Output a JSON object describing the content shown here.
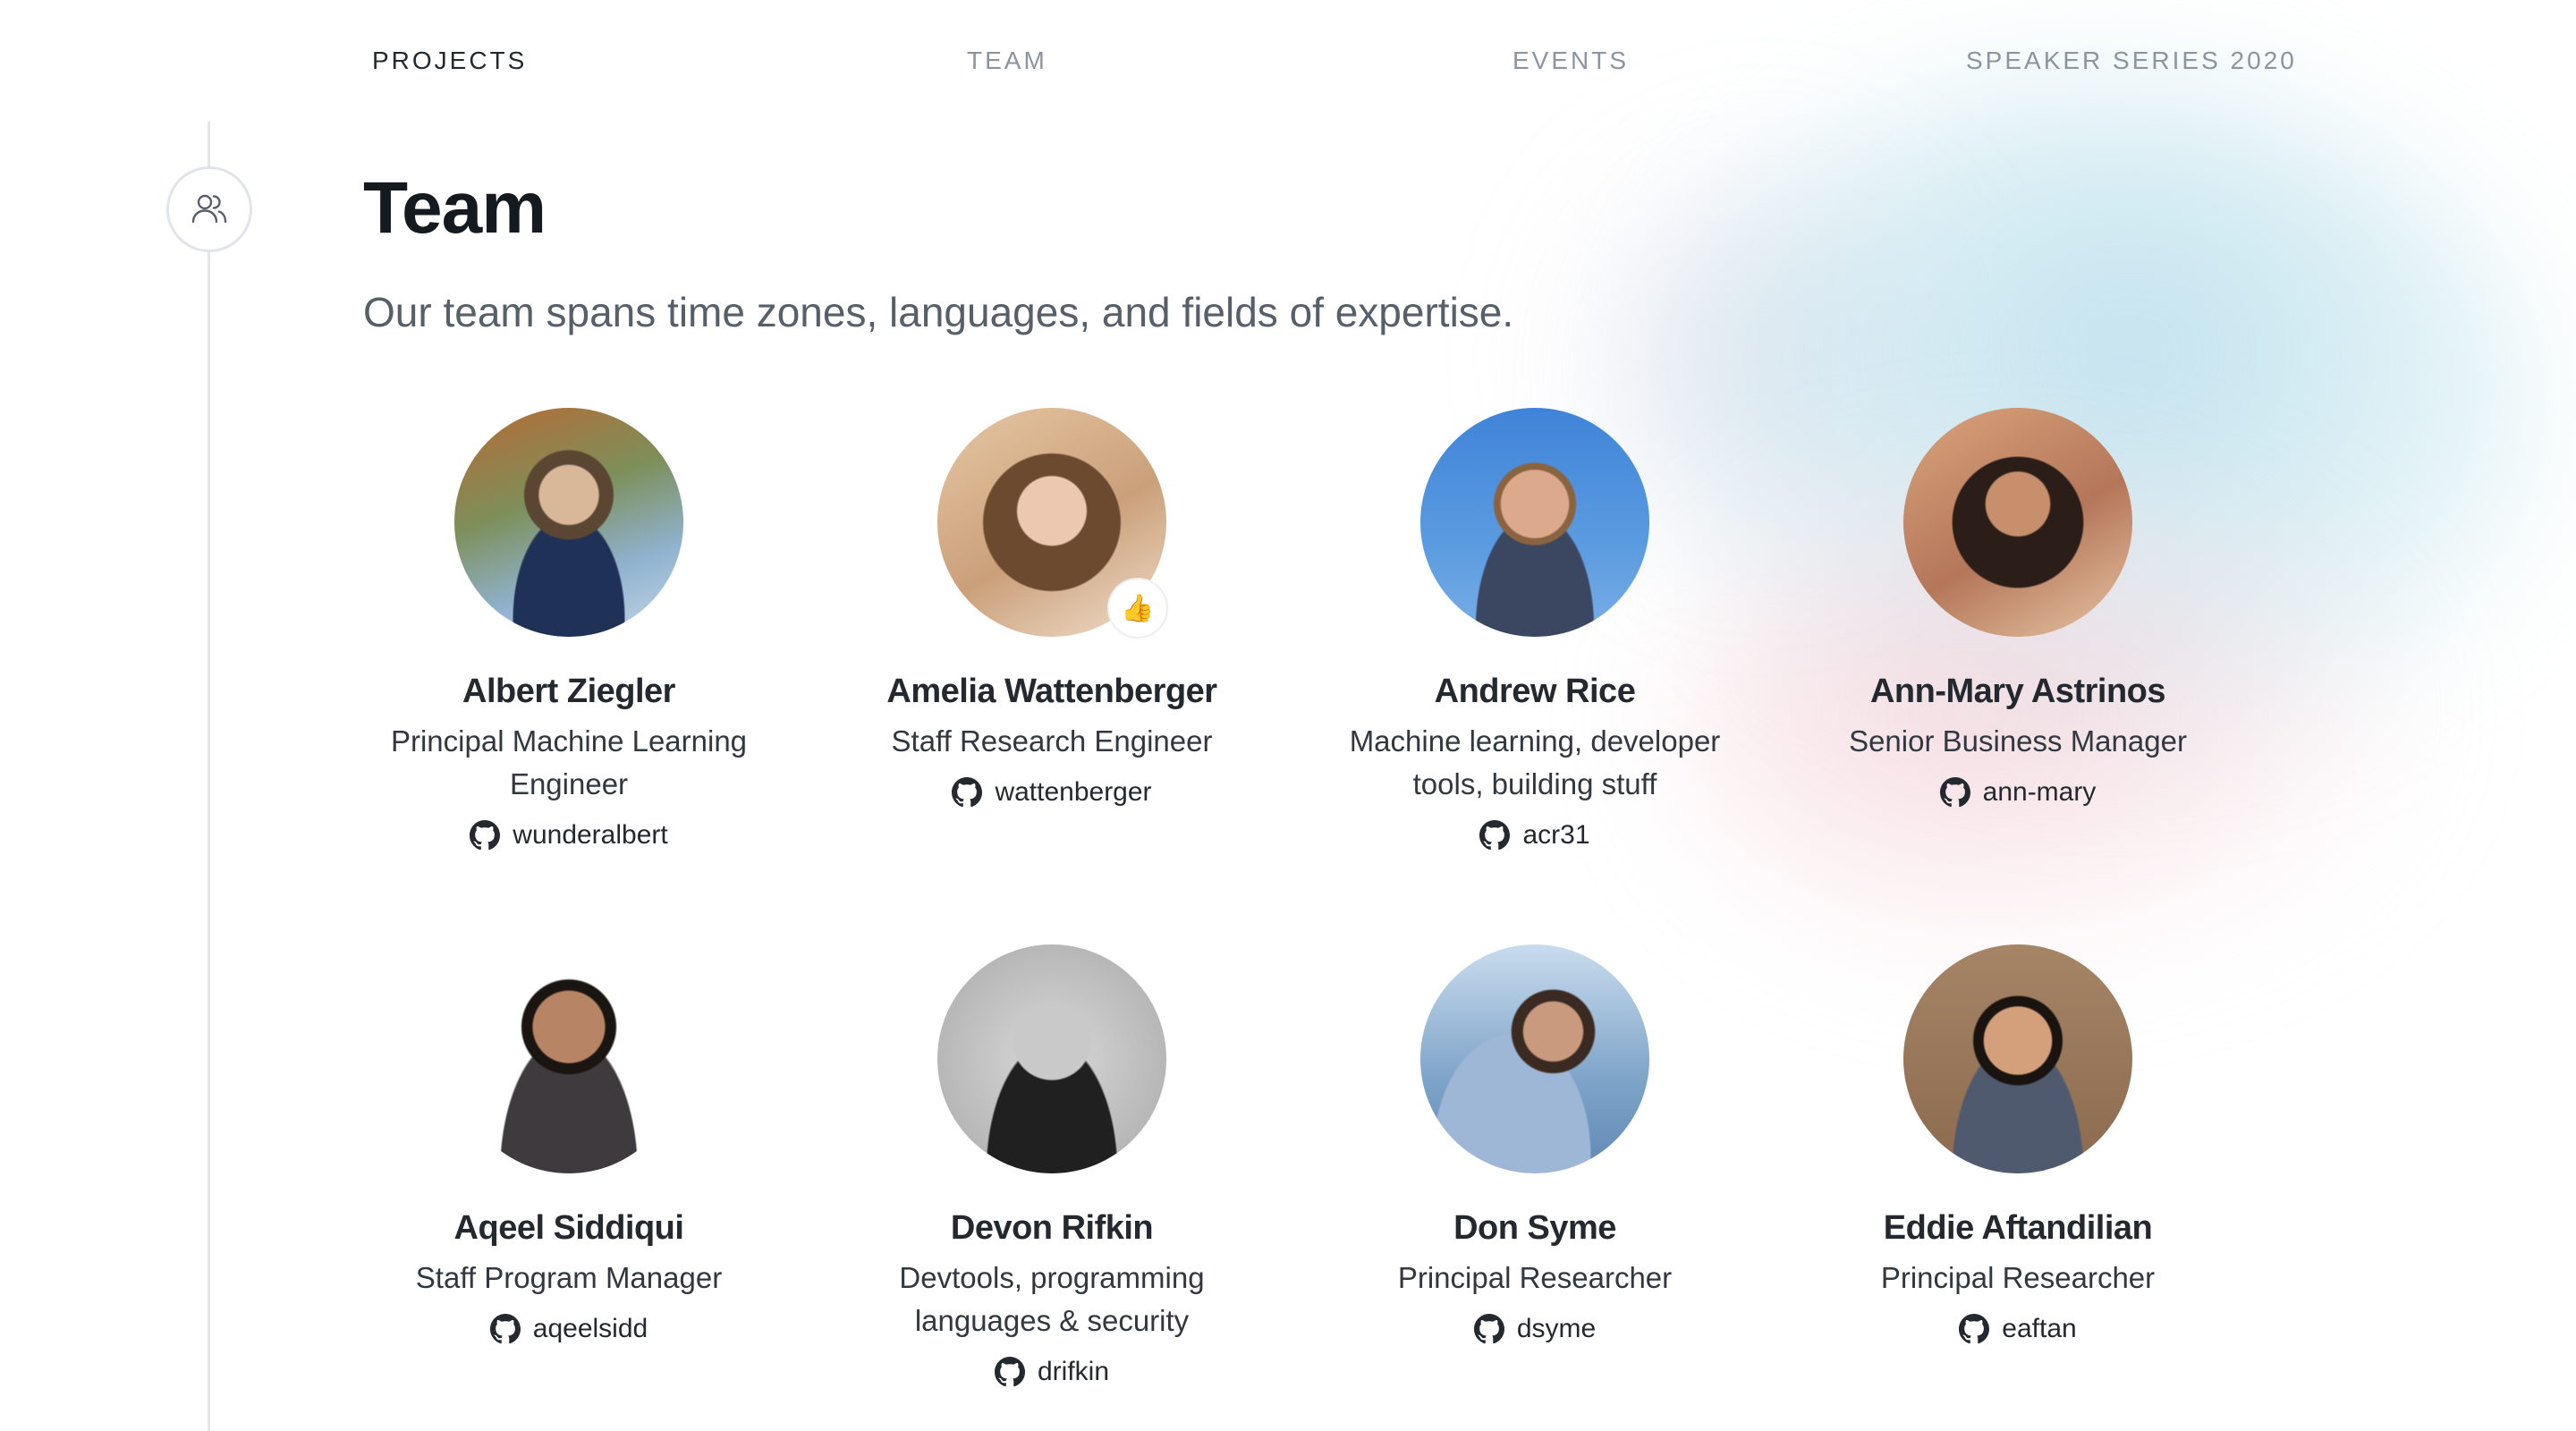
{
  "nav": {
    "items": [
      {
        "label": "PROJECTS",
        "active": true
      },
      {
        "label": "TEAM",
        "active": false
      },
      {
        "label": "EVENTS",
        "active": false
      },
      {
        "label": "SPEAKER SERIES 2020",
        "active": false
      }
    ]
  },
  "section": {
    "icon": "people-icon",
    "title": "Team",
    "subtitle": "Our team spans time zones, languages, and fields of expertise."
  },
  "members": [
    {
      "name": "Albert Ziegler",
      "role": "Principal Machine Learning Engineer",
      "github": "wunderalbert",
      "avatar_color": "#8a7a5c"
    },
    {
      "name": "Amelia Wattenberger",
      "role": "Staff Research Engineer",
      "github": "wattenberger",
      "avatar_color": "#c9a07e",
      "badge": "👍"
    },
    {
      "name": "Andrew Rice",
      "role": "Machine learning, developer tools, building stuff",
      "github": "acr31",
      "avatar_color": "#4f8fd6"
    },
    {
      "name": "Ann-Mary Astrinos",
      "role": "Senior Business Manager",
      "github": "ann-mary",
      "avatar_color": "#8a5a44"
    },
    {
      "name": "Aqeel Siddiqui",
      "role": "Staff Program Manager",
      "github": "aqeelsidd",
      "avatar_color": "#5b4a44"
    },
    {
      "name": "Devon Rifkin",
      "role": "Devtools, programming languages & security",
      "github": "drifkin",
      "avatar_color": "#9a9a9a"
    },
    {
      "name": "Don Syme",
      "role": "Principal Researcher",
      "github": "dsyme",
      "avatar_color": "#6f93b8"
    },
    {
      "name": "Eddie Aftandilian",
      "role": "Principal Researcher",
      "github": "eaftan",
      "avatar_color": "#8c7058"
    }
  ]
}
